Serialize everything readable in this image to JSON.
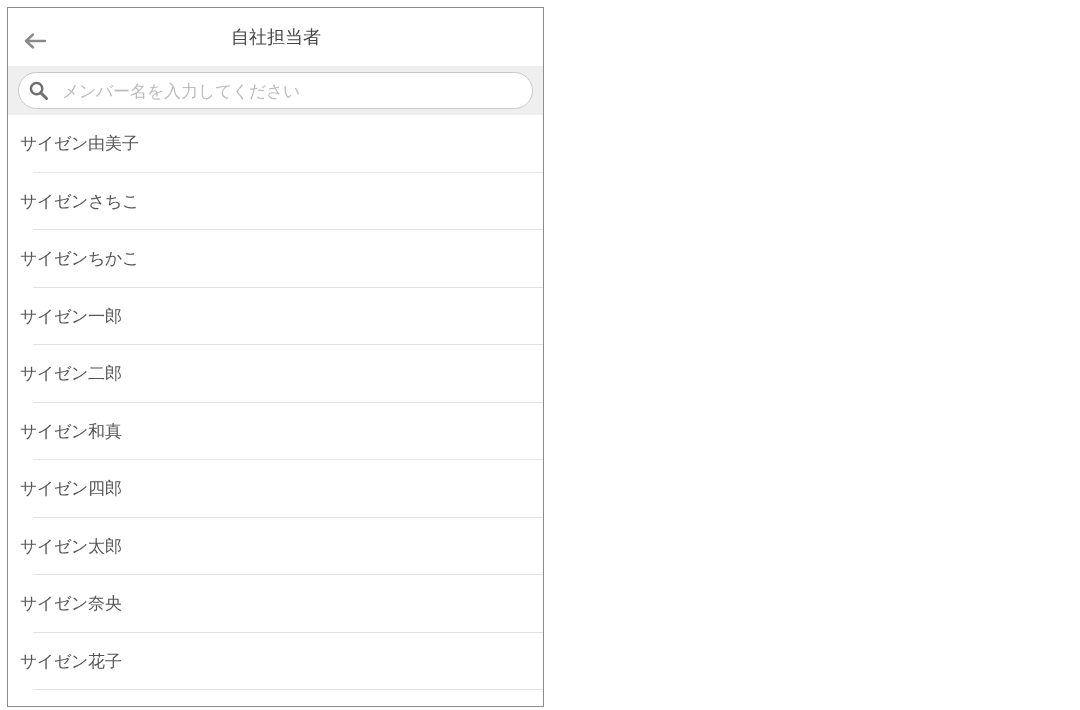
{
  "header": {
    "title": "自社担当者"
  },
  "search": {
    "placeholder": "メンバー名を入力してください"
  },
  "members": [
    {
      "name": "サイゼン由美子"
    },
    {
      "name": "サイゼンさちこ"
    },
    {
      "name": "サイゼンちかこ"
    },
    {
      "name": "サイゼン一郎"
    },
    {
      "name": "サイゼン二郎"
    },
    {
      "name": "サイゼン和真"
    },
    {
      "name": "サイゼン四郎"
    },
    {
      "name": "サイゼン太郎"
    },
    {
      "name": "サイゼン奈央"
    },
    {
      "name": "サイゼン花子"
    }
  ]
}
